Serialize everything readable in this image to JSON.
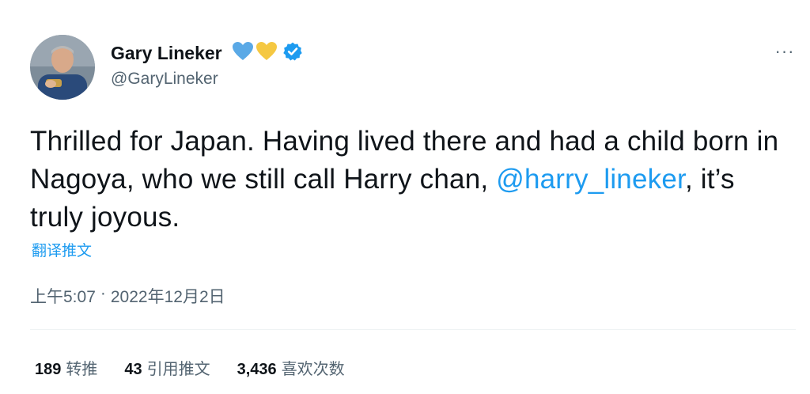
{
  "author": {
    "display_name": "Gary Lineker",
    "handle": "@GaryLineker",
    "avatar_icon": "profile-photo",
    "emojis": [
      "blue-heart-icon",
      "yellow-heart-icon"
    ],
    "verified_icon": "verified-badge-icon"
  },
  "menu": {
    "more_label": "···"
  },
  "tweet": {
    "text_before": "Thrilled for Japan. Having lived there and had a child born in Nagoya, who we still call Harry chan, ",
    "mention": "@harry_lineker",
    "text_after": ", it’s truly joyous.",
    "translate_label": "翻译推文"
  },
  "meta": {
    "time": "上午5:07",
    "separator": "·",
    "date": "2022年12月2日"
  },
  "stats": {
    "retweets": {
      "count": "189",
      "label": "转推"
    },
    "quotes": {
      "count": "43",
      "label": "引用推文"
    },
    "likes": {
      "count": "3,436",
      "label": "喜欢次数"
    }
  },
  "colors": {
    "link": "#1d9bf0",
    "secondary_text": "#536471",
    "primary_text": "#0f1419",
    "heart_blue": "#5aa9e6",
    "heart_yellow": "#f5c842"
  }
}
